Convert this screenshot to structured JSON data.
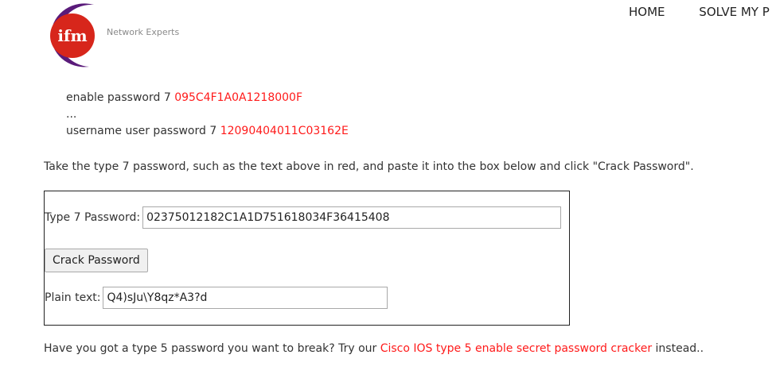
{
  "header": {
    "logo_text": "ifm",
    "tagline": "Network Experts",
    "nav": [
      "HOME",
      "SOLVE MY P"
    ]
  },
  "config_example": {
    "line1_prefix": "enable password 7 ",
    "line1_hash": "095C4F1A0A1218000F",
    "ellipsis": "...",
    "line3_prefix": "username user password 7 ",
    "line3_hash": "12090404011C03162E"
  },
  "instructions": "Take the type 7 password, such as the text above in red, and paste it into the box below and click \"Crack Password\".",
  "form": {
    "password_label": "Type 7 Password:",
    "password_value": "02375012182C1A1D751618034F36415408",
    "button_label": "Crack Password",
    "plaintext_label": "Plain text:",
    "plaintext_value": "Q4)sJu\\Y8qz*A3?d"
  },
  "footer": {
    "prefix": "Have you got a type 5 password you want to break? Try our ",
    "link_text": "Cisco IOS type 5 enable secret password cracker",
    "suffix": " instead.."
  },
  "colors": {
    "accent": "#ff1a1a",
    "logo_red": "#d7261b",
    "logo_purple": "#5a1b7a"
  }
}
